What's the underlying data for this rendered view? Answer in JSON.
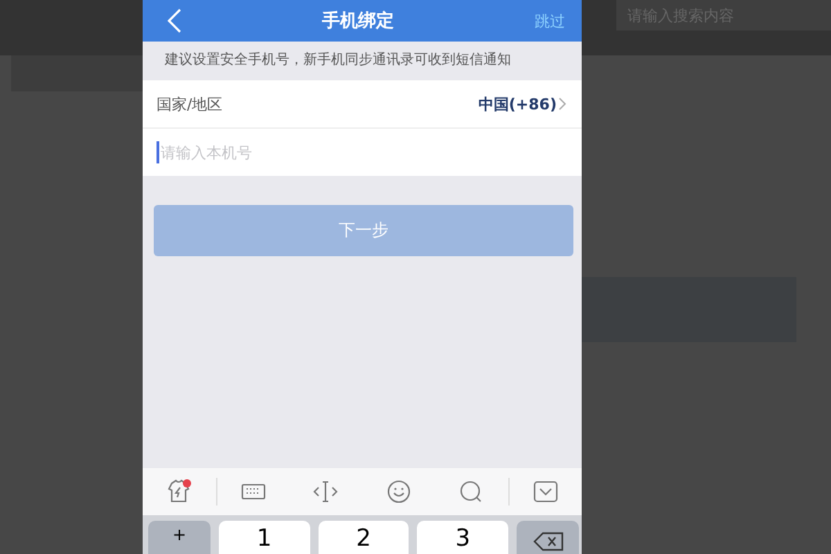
{
  "background": {
    "search": {
      "placeholder": "请输入搜索内容"
    }
  },
  "phone": {
    "header": {
      "title": "手机绑定",
      "action": "跳过"
    },
    "hint": "建议设置安全手机号，新手机同步通讯录可收到短信通知",
    "country": {
      "label": "国家/地区",
      "value": "中国(+86)"
    },
    "phone_field": {
      "placeholder": "请输入本机号"
    },
    "next_button": {
      "label": "下一步",
      "disabled": true
    },
    "keyboard": {
      "toolbar": [
        {
          "kind": "skin"
        },
        {
          "kind": "keyboard"
        },
        {
          "kind": "cursor"
        },
        {
          "kind": "emoji"
        },
        {
          "kind": "search"
        },
        {
          "kind": "collapse"
        }
      ],
      "keys": [
        {
          "kind": "function",
          "label": "+"
        },
        {
          "kind": "digit",
          "label": "1"
        },
        {
          "kind": "digit",
          "label": "2"
        },
        {
          "kind": "digit",
          "label": "3"
        },
        {
          "kind": "delete"
        }
      ]
    }
  }
}
